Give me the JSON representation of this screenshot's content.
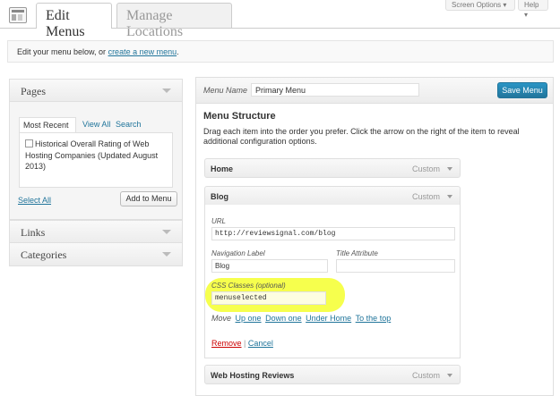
{
  "header": {
    "tab_edit": "Edit Menus",
    "tab_manage": "Manage Locations",
    "screen_options": "Screen Options ▾",
    "help": "Help ▾"
  },
  "notice": {
    "text": "Edit your menu below, or ",
    "link": "create a new menu",
    "suffix": "."
  },
  "left": {
    "pages_title": "Pages",
    "subtabs": [
      "Most Recent",
      "View All",
      "Search"
    ],
    "page_item": "Historical Overall Rating of Web Hosting Companies (Updated August 2013)",
    "select_all": "Select All",
    "add_to_menu": "Add to Menu",
    "links_title": "Links",
    "categories_title": "Categories"
  },
  "right": {
    "menu_name_label": "Menu Name",
    "menu_name_value": "Primary Menu",
    "save_menu": "Save Menu",
    "structure_title": "Menu Structure",
    "structure_desc": "Drag each item into the order you prefer. Click the arrow on the right of the item to reveal additional configuration options.",
    "items": [
      {
        "title": "Home",
        "type": "Custom"
      },
      {
        "title": "Blog",
        "type": "Custom"
      },
      {
        "title": "Web Hosting Reviews",
        "type": "Custom"
      }
    ],
    "blog": {
      "url_label": "URL",
      "url_value": "http://reviewsignal.com/blog",
      "nav_label": "Navigation Label",
      "nav_value": "Blog",
      "attr_label": "Title Attribute",
      "attr_value": "",
      "css_label": "CSS Classes (optional)",
      "css_value": "menuselected",
      "move_label": "Move",
      "move_links": [
        "Up one",
        "Down one",
        "Under Home",
        "To the top"
      ],
      "remove": "Remove",
      "separator": "|",
      "cancel": "Cancel"
    }
  }
}
